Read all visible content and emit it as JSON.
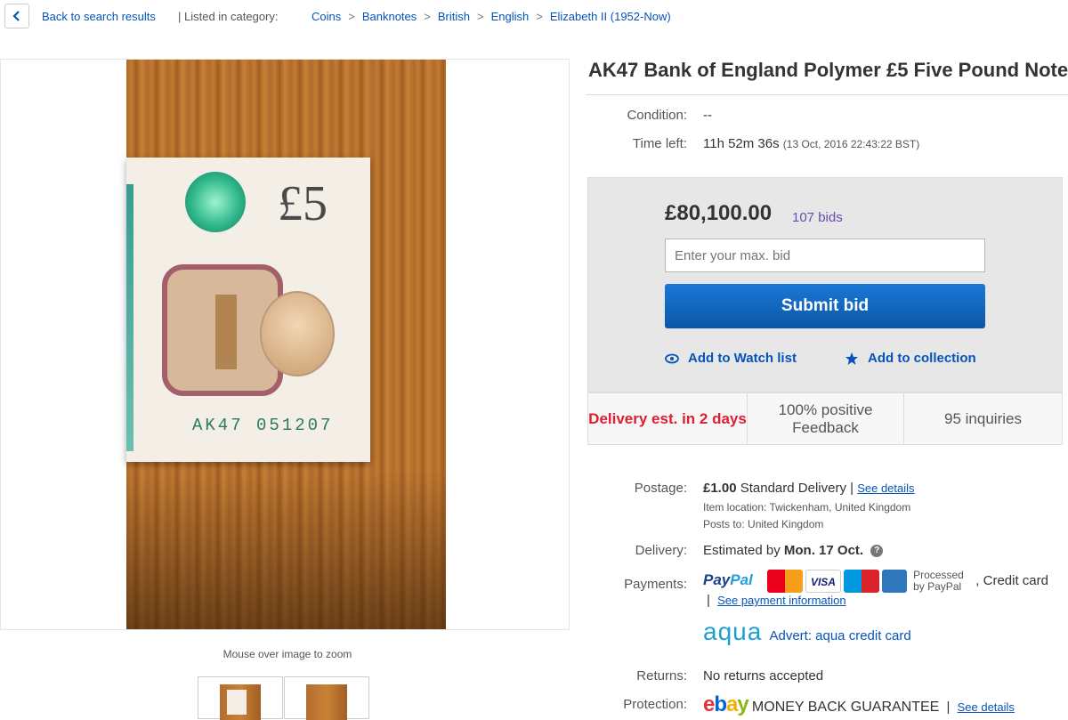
{
  "breadcrumb": {
    "back_label": "Back to search results",
    "listed_label": "| Listed in category:",
    "categories": [
      "Coins",
      "Banknotes",
      "British",
      "English",
      "Elizabeth II (1952-Now)"
    ],
    "separator": ">"
  },
  "gallery": {
    "note_denomination": "£5",
    "note_serial": "AK47 051207",
    "zoom_hint": "Mouse over image to zoom"
  },
  "listing": {
    "title": "AK47 Bank of England Polymer £5 Five Pound Note",
    "condition_label": "Condition:",
    "condition_value": "--",
    "time_left_label": "Time left:",
    "time_left_value": "11h 52m 36s",
    "time_left_end": "(13 Oct, 2016   22:43:22 BST)"
  },
  "bid": {
    "price": "£80,100.00",
    "bid_count": "107 bids",
    "input_placeholder": "Enter your max. bid",
    "submit_label": "Submit bid",
    "watch_label": "Add to Watch list",
    "collection_label": "Add to collection"
  },
  "stats": {
    "delivery": "Delivery est. in 2 days",
    "feedback": "100% positive Feedback",
    "inquiries": "95 inquiries"
  },
  "details": {
    "postage_label": "Postage:",
    "postage_price": "£1.00",
    "postage_service": "Standard Delivery",
    "postage_sep": "|",
    "see_details": "See details",
    "item_location": "Item location:  Twickenham, United Kingdom",
    "posts_to": "Posts to:  United Kingdom",
    "delivery_label": "Delivery:",
    "delivery_prefix": "Estimated by",
    "delivery_date": "Mon. 17 Oct.",
    "delivery_help": "?",
    "payments_label": "Payments:",
    "paypal_pay": "Pay",
    "paypal_pal": "Pal",
    "card_visa": "VISA",
    "processed_by": "Processed by PayPal",
    "credit_card": ", Credit card",
    "see_payment": "See payment information",
    "aqua_logo": "aqua",
    "aqua_advert": "Advert: aqua credit card",
    "returns_label": "Returns:",
    "returns_value": "No returns accepted",
    "protection_label": "Protection:",
    "ebay_logo": [
      "e",
      "b",
      "a",
      "y"
    ],
    "money_back": "MONEY BACK GUARANTEE",
    "protection_see_details": "See details"
  },
  "colors": {
    "link": "#0654ba",
    "button_blue": "#0b57a8",
    "alert_red": "#dd1e31",
    "bids_purple": "#6a4bb5",
    "paypal_dark": "#1b3f8b",
    "paypal_light": "#1f9fe0",
    "aqua": "#1e9fd0",
    "ebay_e": "#e53238",
    "ebay_b": "#0064d2",
    "ebay_a": "#f5af02",
    "ebay_y": "#86b817"
  },
  "icons": {
    "back": "chevron-left-icon",
    "watch": "eye-icon",
    "collection": "star-icon",
    "delivery_help": "question-circle-icon",
    "cards": [
      "mastercard-icon",
      "visa-icon",
      "maestro-icon",
      "american-express-icon"
    ]
  }
}
